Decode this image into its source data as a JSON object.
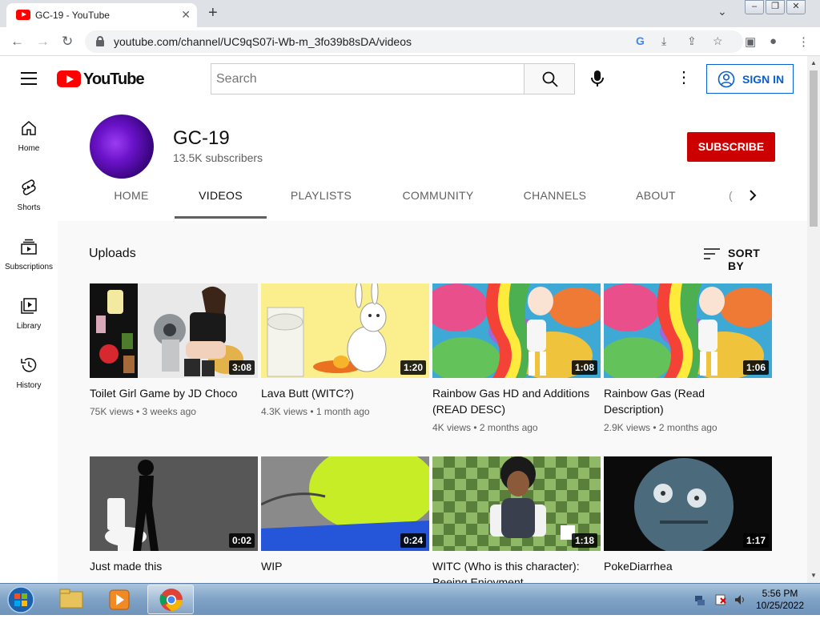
{
  "browser": {
    "tab_title": "GC-19 - YouTube",
    "tab_close": "✕",
    "new_tab": "+",
    "url": "youtube.com/channel/UC9qS07i-Wb-m_3fo39b8sDA/videos",
    "win_minimize": "–",
    "win_restore": "❐",
    "win_close": "✕"
  },
  "masthead": {
    "logo_text": "YouTube",
    "search_placeholder": "Search",
    "more": "⋮",
    "sign_in": "SIGN IN"
  },
  "guide": [
    {
      "label": "Home",
      "icon": "home-icon"
    },
    {
      "label": "Shorts",
      "icon": "shorts-icon"
    },
    {
      "label": "Subscriptions",
      "icon": "subscriptions-icon"
    },
    {
      "label": "Library",
      "icon": "library-icon"
    },
    {
      "label": "History",
      "icon": "history-icon"
    }
  ],
  "channel": {
    "name": "GC-19",
    "subscribers": "13.5K subscribers",
    "subscribe": "SUBSCRIBE",
    "tabs": [
      "HOME",
      "VIDEOS",
      "PLAYLISTS",
      "COMMUNITY",
      "CHANNELS",
      "ABOUT"
    ],
    "active_tab": "VIDEOS",
    "tab_overflow": "("
  },
  "uploads": {
    "title": "Uploads",
    "sort_by": "SORT BY",
    "videos": [
      {
        "title": "Toilet Girl Game by JD Choco",
        "meta": "75K views • 3 weeks ago",
        "duration": "3:08"
      },
      {
        "title": "Lava Butt (WITC?)",
        "meta": "4.3K views • 1 month ago",
        "duration": "1:20"
      },
      {
        "title": "Rainbow Gas HD and Additions (READ DESC)",
        "meta": "4K views • 2 months ago",
        "duration": "1:08"
      },
      {
        "title": "Rainbow Gas (Read Description)",
        "meta": "2.9K views • 2 months ago",
        "duration": "1:06"
      },
      {
        "title": "Just made this",
        "meta": "",
        "duration": "0:02"
      },
      {
        "title": "WIP",
        "meta": "",
        "duration": "0:24"
      },
      {
        "title": "WITC (Who is this character): Peeing Enjoyment",
        "meta": "",
        "duration": "1:18"
      },
      {
        "title": "PokeDiarrhea",
        "meta": "",
        "duration": "1:17"
      }
    ]
  },
  "taskbar": {
    "time": "5:56 PM",
    "date": "10/25/2022"
  },
  "colors": {
    "youtube_red": "#ff0000",
    "subscribe_red": "#cc0000",
    "link_blue": "#065fd4"
  }
}
